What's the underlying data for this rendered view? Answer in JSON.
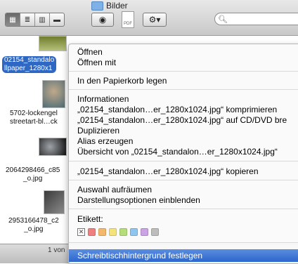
{
  "window": {
    "title": "Bilder"
  },
  "toolbar": {
    "view_buttons": [
      "icon-view",
      "list-view",
      "column-view",
      "coverflow-view"
    ],
    "pdf_label": "PDF",
    "search_placeholder": ""
  },
  "files": [
    {
      "label_line1": "02154_standalo",
      "label_line2": "llpaper_1280x1",
      "selected": true
    },
    {
      "label_line1": "5702-lockengel",
      "label_line2": "streetart-bl…ck",
      "selected": false
    },
    {
      "label_line1": "2064298466_c85",
      "label_line2": "_o.jpg",
      "selected": false
    },
    {
      "label_line1": "2953166478_c2",
      "label_line2": "_o.jpg",
      "selected": false
    }
  ],
  "status": {
    "text": "1 von"
  },
  "context_menu": {
    "group1": [
      "Öffnen",
      "Öffnen mit"
    ],
    "group2": [
      "In den Papierkorb legen"
    ],
    "group3": [
      "Informationen",
      "„02154_standalon…er_1280x1024.jpg“ komprimieren",
      "„02154_standalon…er_1280x1024.jpg“ auf CD/DVD bre",
      "Duplizieren",
      "Alias erzeugen",
      "Übersicht von „02154_standalon…er_1280x1024.jpg“"
    ],
    "group4": [
      "„02154_standalon…er_1280x1024.jpg“ kopieren"
    ],
    "group5": [
      "Auswahl aufräumen",
      "Darstellungsoptionen einblenden"
    ],
    "labels_title": "Etikett:",
    "labels_clear": "✕",
    "label_colors": [
      "#f08080",
      "#f5b86a",
      "#f3e37a",
      "#b5de7a",
      "#8fc6f0",
      "#c9a3e3",
      "#bdbdbd"
    ],
    "highlighted_item": "Schreibtischhintergrund festlegen"
  },
  "colors": {
    "selection": "#2f68c4",
    "menu_highlight": "#2d66cc"
  }
}
